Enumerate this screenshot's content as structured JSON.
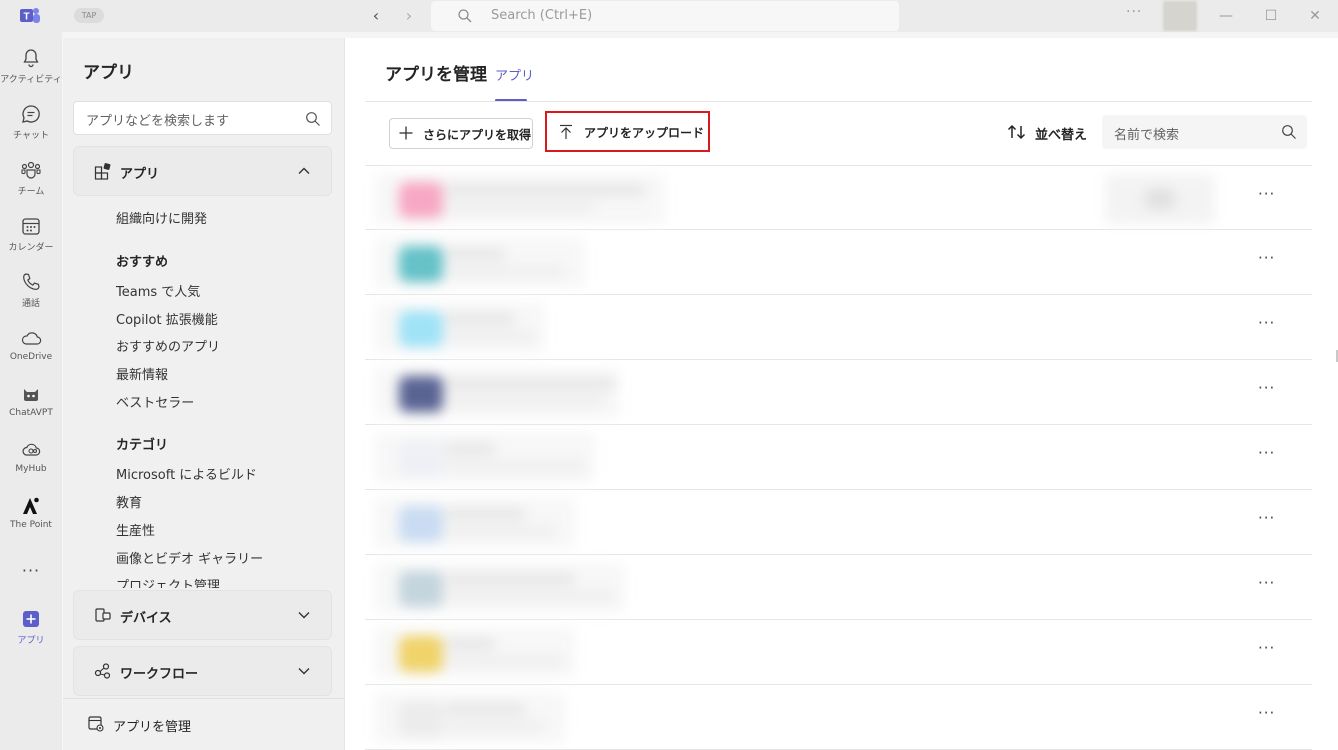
{
  "titlebar": {
    "tag": "TAP",
    "search_placeholder": "Search (Ctrl+E)",
    "more": "···",
    "min": "—",
    "max": "☐",
    "close": "✕"
  },
  "rail": [
    {
      "label": "アクティビティ",
      "icon": "bell-icon"
    },
    {
      "label": "チャット",
      "icon": "chat-icon"
    },
    {
      "label": "チーム",
      "icon": "teams-icon"
    },
    {
      "label": "カレンダー",
      "icon": "calendar-icon"
    },
    {
      "label": "通話",
      "icon": "phone-icon"
    },
    {
      "label": "OneDrive",
      "icon": "cloud-icon"
    },
    {
      "label": "ChatAVPT",
      "icon": "bot-icon"
    },
    {
      "label": "MyHub",
      "icon": "hub-icon"
    },
    {
      "label": "The Point",
      "icon": "point-icon"
    },
    {
      "label": "アプリ",
      "icon": "plus-app-icon"
    }
  ],
  "rail_more": "···",
  "sidebar": {
    "title": "アプリ",
    "search_placeholder": "アプリなどを検索します",
    "section_apps": "アプリ",
    "build_link": "組織向けに開発",
    "heading_recommended": "おすすめ",
    "recommended": [
      "Teams で人気",
      "Copilot 拡張機能",
      "おすすめのアプリ",
      "最新情報",
      "ベストセラー"
    ],
    "heading_categories": "カテゴリ",
    "categories": [
      "Microsoft によるビルド",
      "教育",
      "生産性",
      "画像とビデオ ギャラリー",
      "プロジェクト管理"
    ],
    "section_devices": "デバイス",
    "section_workflows": "ワークフロー",
    "manage_apps": "アプリを管理"
  },
  "main": {
    "title": "アプリを管理",
    "tab": "アプリ",
    "get_more": "さらにアプリを取得",
    "upload": "アプリをアップロード",
    "sort": "並べ替え",
    "search_placeholder": "名前で検索",
    "row_more": "···"
  },
  "colors": {
    "accent": "#5b5fc7",
    "highlight_border": "#d91a1a"
  }
}
